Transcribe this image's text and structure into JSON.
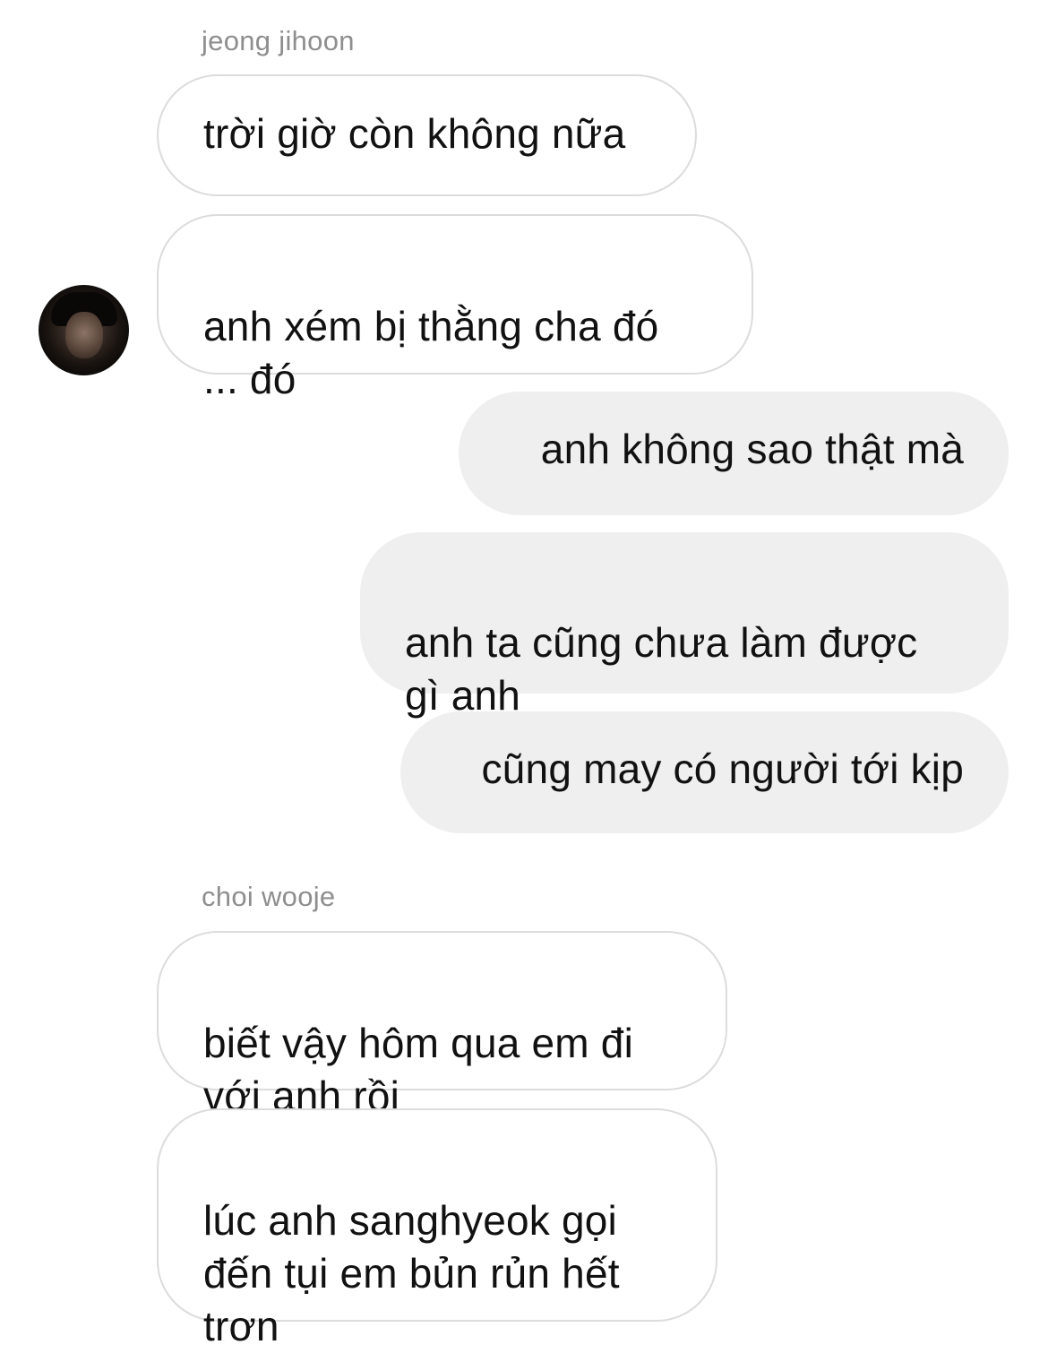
{
  "conversation": {
    "groups": [
      {
        "sender": "jeong jihoon",
        "messages": [
          "trời giờ còn không nữa",
          "anh xém bị thằng cha đó\n... đó"
        ]
      },
      {
        "sender": "",
        "outgoing": true,
        "messages": [
          "anh không sao thật mà",
          "anh ta cũng chưa làm được\ngì anh",
          "cũng may có người tới kịp"
        ]
      },
      {
        "sender": "choi wooje",
        "messages": [
          "biết vậy hôm qua em đi\nvới anh rồi",
          "lúc anh sanghyeok gọi\nđến tụi em bủn rủn hết\ntrơn"
        ]
      }
    ]
  },
  "colors": {
    "incoming_bubble_border": "#dcdcdc",
    "outgoing_bubble_bg": "#efefef",
    "sender_name": "#8e8e8e",
    "text": "#111111"
  },
  "icons": {
    "avatar": "user-avatar-photo"
  }
}
